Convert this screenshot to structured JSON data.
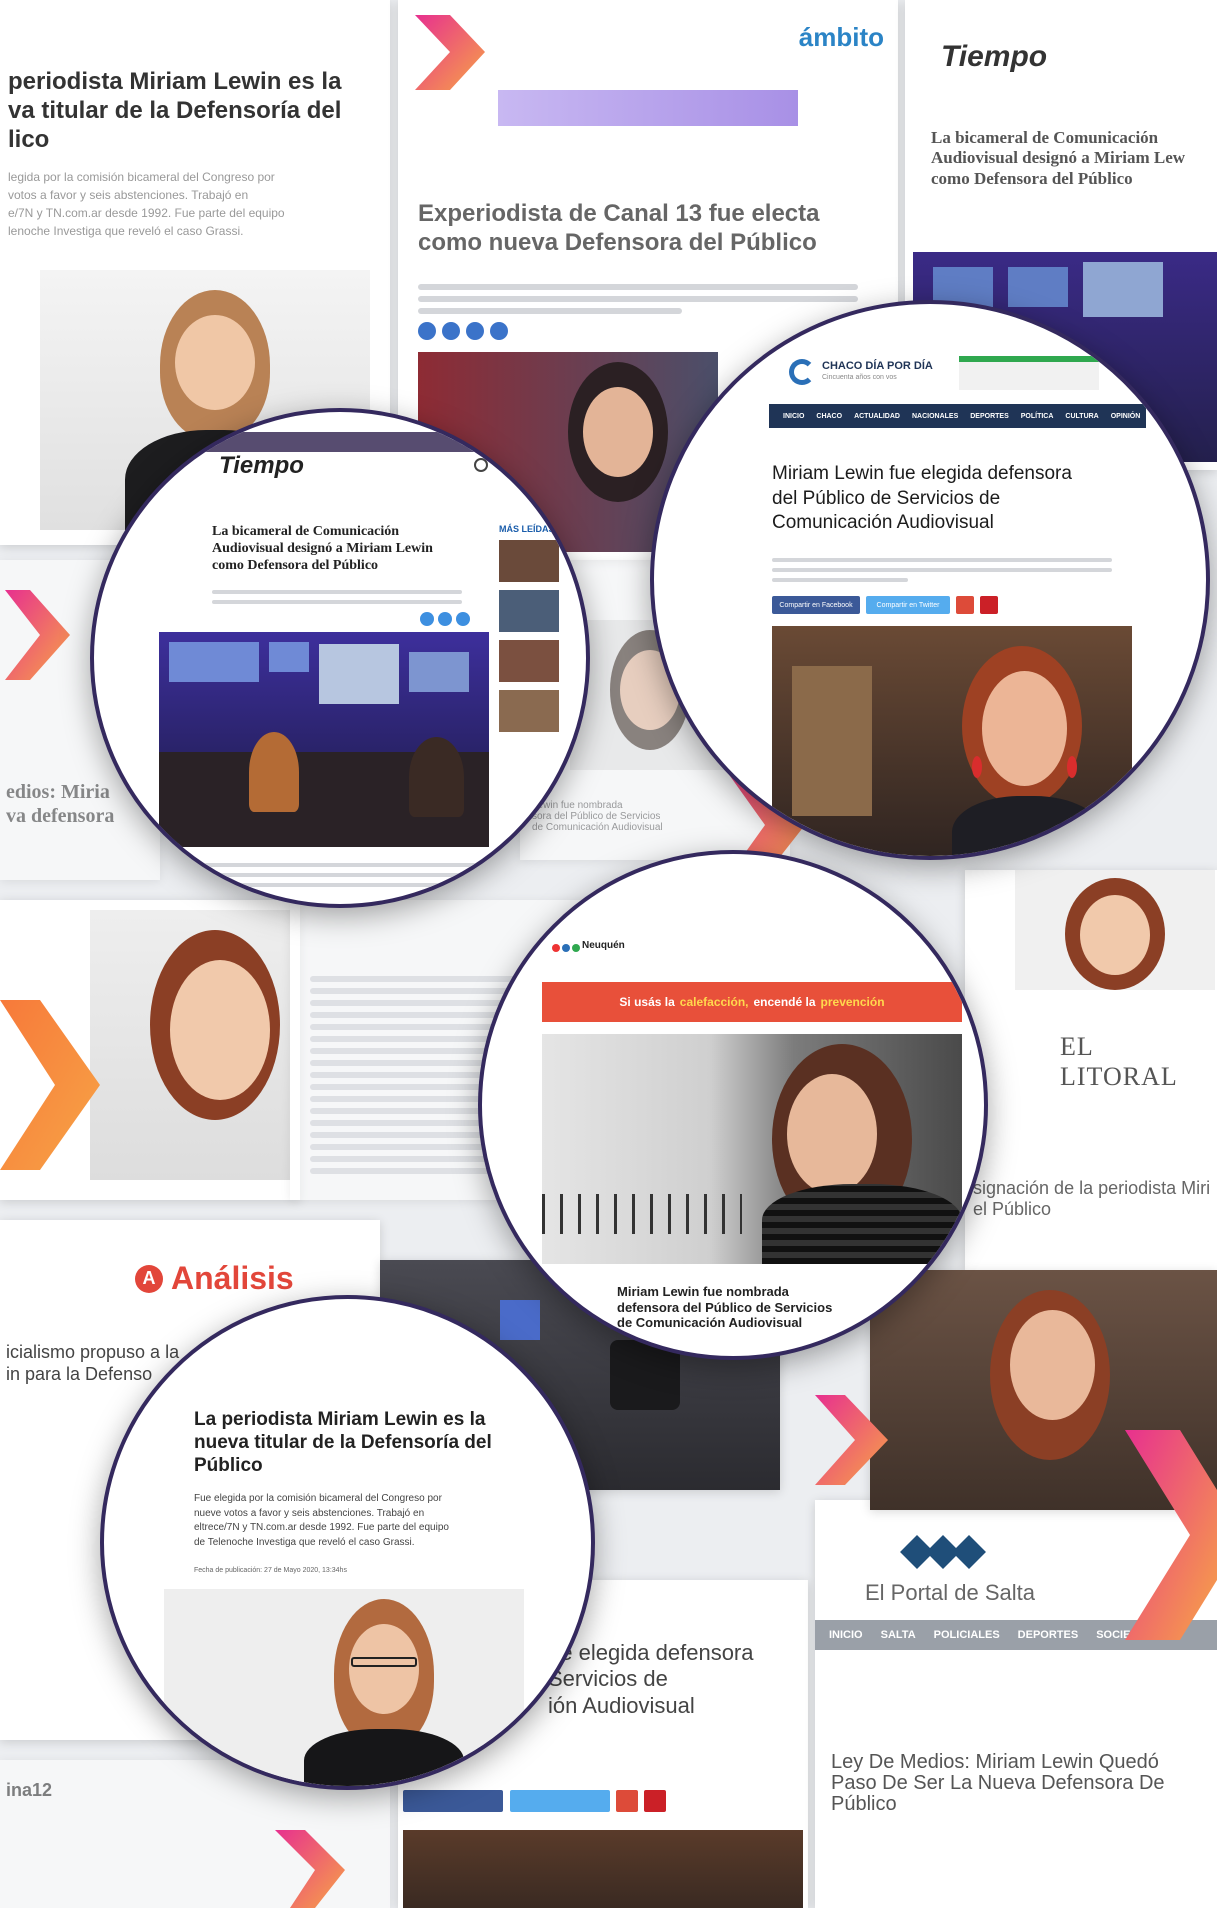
{
  "colors": {
    "accent_purple": "#34295e",
    "chevron_gradient_start": "#e7308f",
    "chevron_gradient_end": "#f7a446",
    "chaco_nav": "#1f3456",
    "neuquen_banner": "#e8503a",
    "analisis_red": "#e2463a"
  },
  "background_clippings": {
    "top_left": {
      "headline": "periodista Miriam Lewin es la\nva titular de la Defensoría del\nlico",
      "summary": "legida por la comisión bicameral del Congreso por\nvotos a favor y seis abstenciones. Trabajó en\ne/7N y TN.com.ar desde 1992. Fue parte del equipo\nlenoche Investiga que reveló el caso Grassi."
    },
    "ambito": {
      "logo": "ámbito",
      "headline": "Experiodista de Canal 13 fue electa\ncomo nueva Defensora del Público"
    },
    "tiempo_top_right": {
      "logo": "Tiempo",
      "headline": "La bicameral de Comunicación\nAudiovisual designó a Miriam Lew\ncomo Defensora del Público"
    },
    "left_middle": {
      "headline": "edios: Miria\nva defensora"
    },
    "el_litoral": {
      "logo": "EL LITORAL",
      "headline": "signación de la periodista Miri\nel Público"
    },
    "analisis": {
      "logo": "Análisis",
      "headline": "icialismo propuso a la\nin para la Defenso"
    },
    "chaco_bottom": {
      "headline": "ue elegida defensora\nServicios de\nión Audiovisual"
    },
    "el_portal": {
      "logo": "El Portal de Salta",
      "nav": [
        "INICIO",
        "SALTA",
        "POLICIALES",
        "DEPORTES",
        "SOCIEDAD"
      ],
      "headline": "Ley De Medios: Miriam Lewin Quedó\nPaso De Ser La Nueva Defensora De\nPúblico"
    },
    "pagina12": {
      "logo": "ina12"
    },
    "center_small": {
      "headline": "Lewin fue nombrada\nsora del Público de Servicios\nde Comunicación Audiovisual"
    }
  },
  "circles": {
    "tiempo": {
      "logo": "Tiempo",
      "headline": "La bicameral de Comunicación\nAudiovisual designó a Miriam Lewin\ncomo Defensora del Público",
      "sidebar_title": "MÁS LEÍDAS"
    },
    "chaco": {
      "logo_line1": "CHACO DÍA POR DÍA",
      "logo_line2": "Cincuenta años con vos",
      "nav": [
        "INICIO",
        "CHACO",
        "ACTUALIDAD",
        "NACIONALES",
        "DEPORTES",
        "POLÍTICA",
        "CULTURA",
        "OPINIÓN"
      ],
      "headline": "Miriam Lewin fue elegida defensora\ndel Público de Servicios de\nComunicación Audiovisual",
      "share_facebook": "Compartir en Facebook",
      "share_twitter": "Compartir en Twitter"
    },
    "neuquen": {
      "logo": "Neuquén",
      "banner_pre": "Si usás la",
      "banner_mid1": "calefacción,",
      "banner_mid2": "encendé la",
      "banner_post": "prevención",
      "headline": "Miriam Lewin fue nombrada\ndefensora del Público de Servicios\nde Comunicación Audiovisual"
    },
    "tn": {
      "headline": "La periodista Miriam Lewin es la\nnueva titular de la Defensoría del\nPúblico",
      "summary": "Fue elegida por la comisión bicameral del Congreso por\nnueve votos a favor y seis abstenciones. Trabajó en\neltrece/7N y TN.com.ar desde 1992. Fue parte del equipo\nde Telenoche Investiga que reveló el caso Grassi.",
      "date_line": "Fecha de publicación: 27 de Mayo 2020, 13:34hs"
    }
  }
}
